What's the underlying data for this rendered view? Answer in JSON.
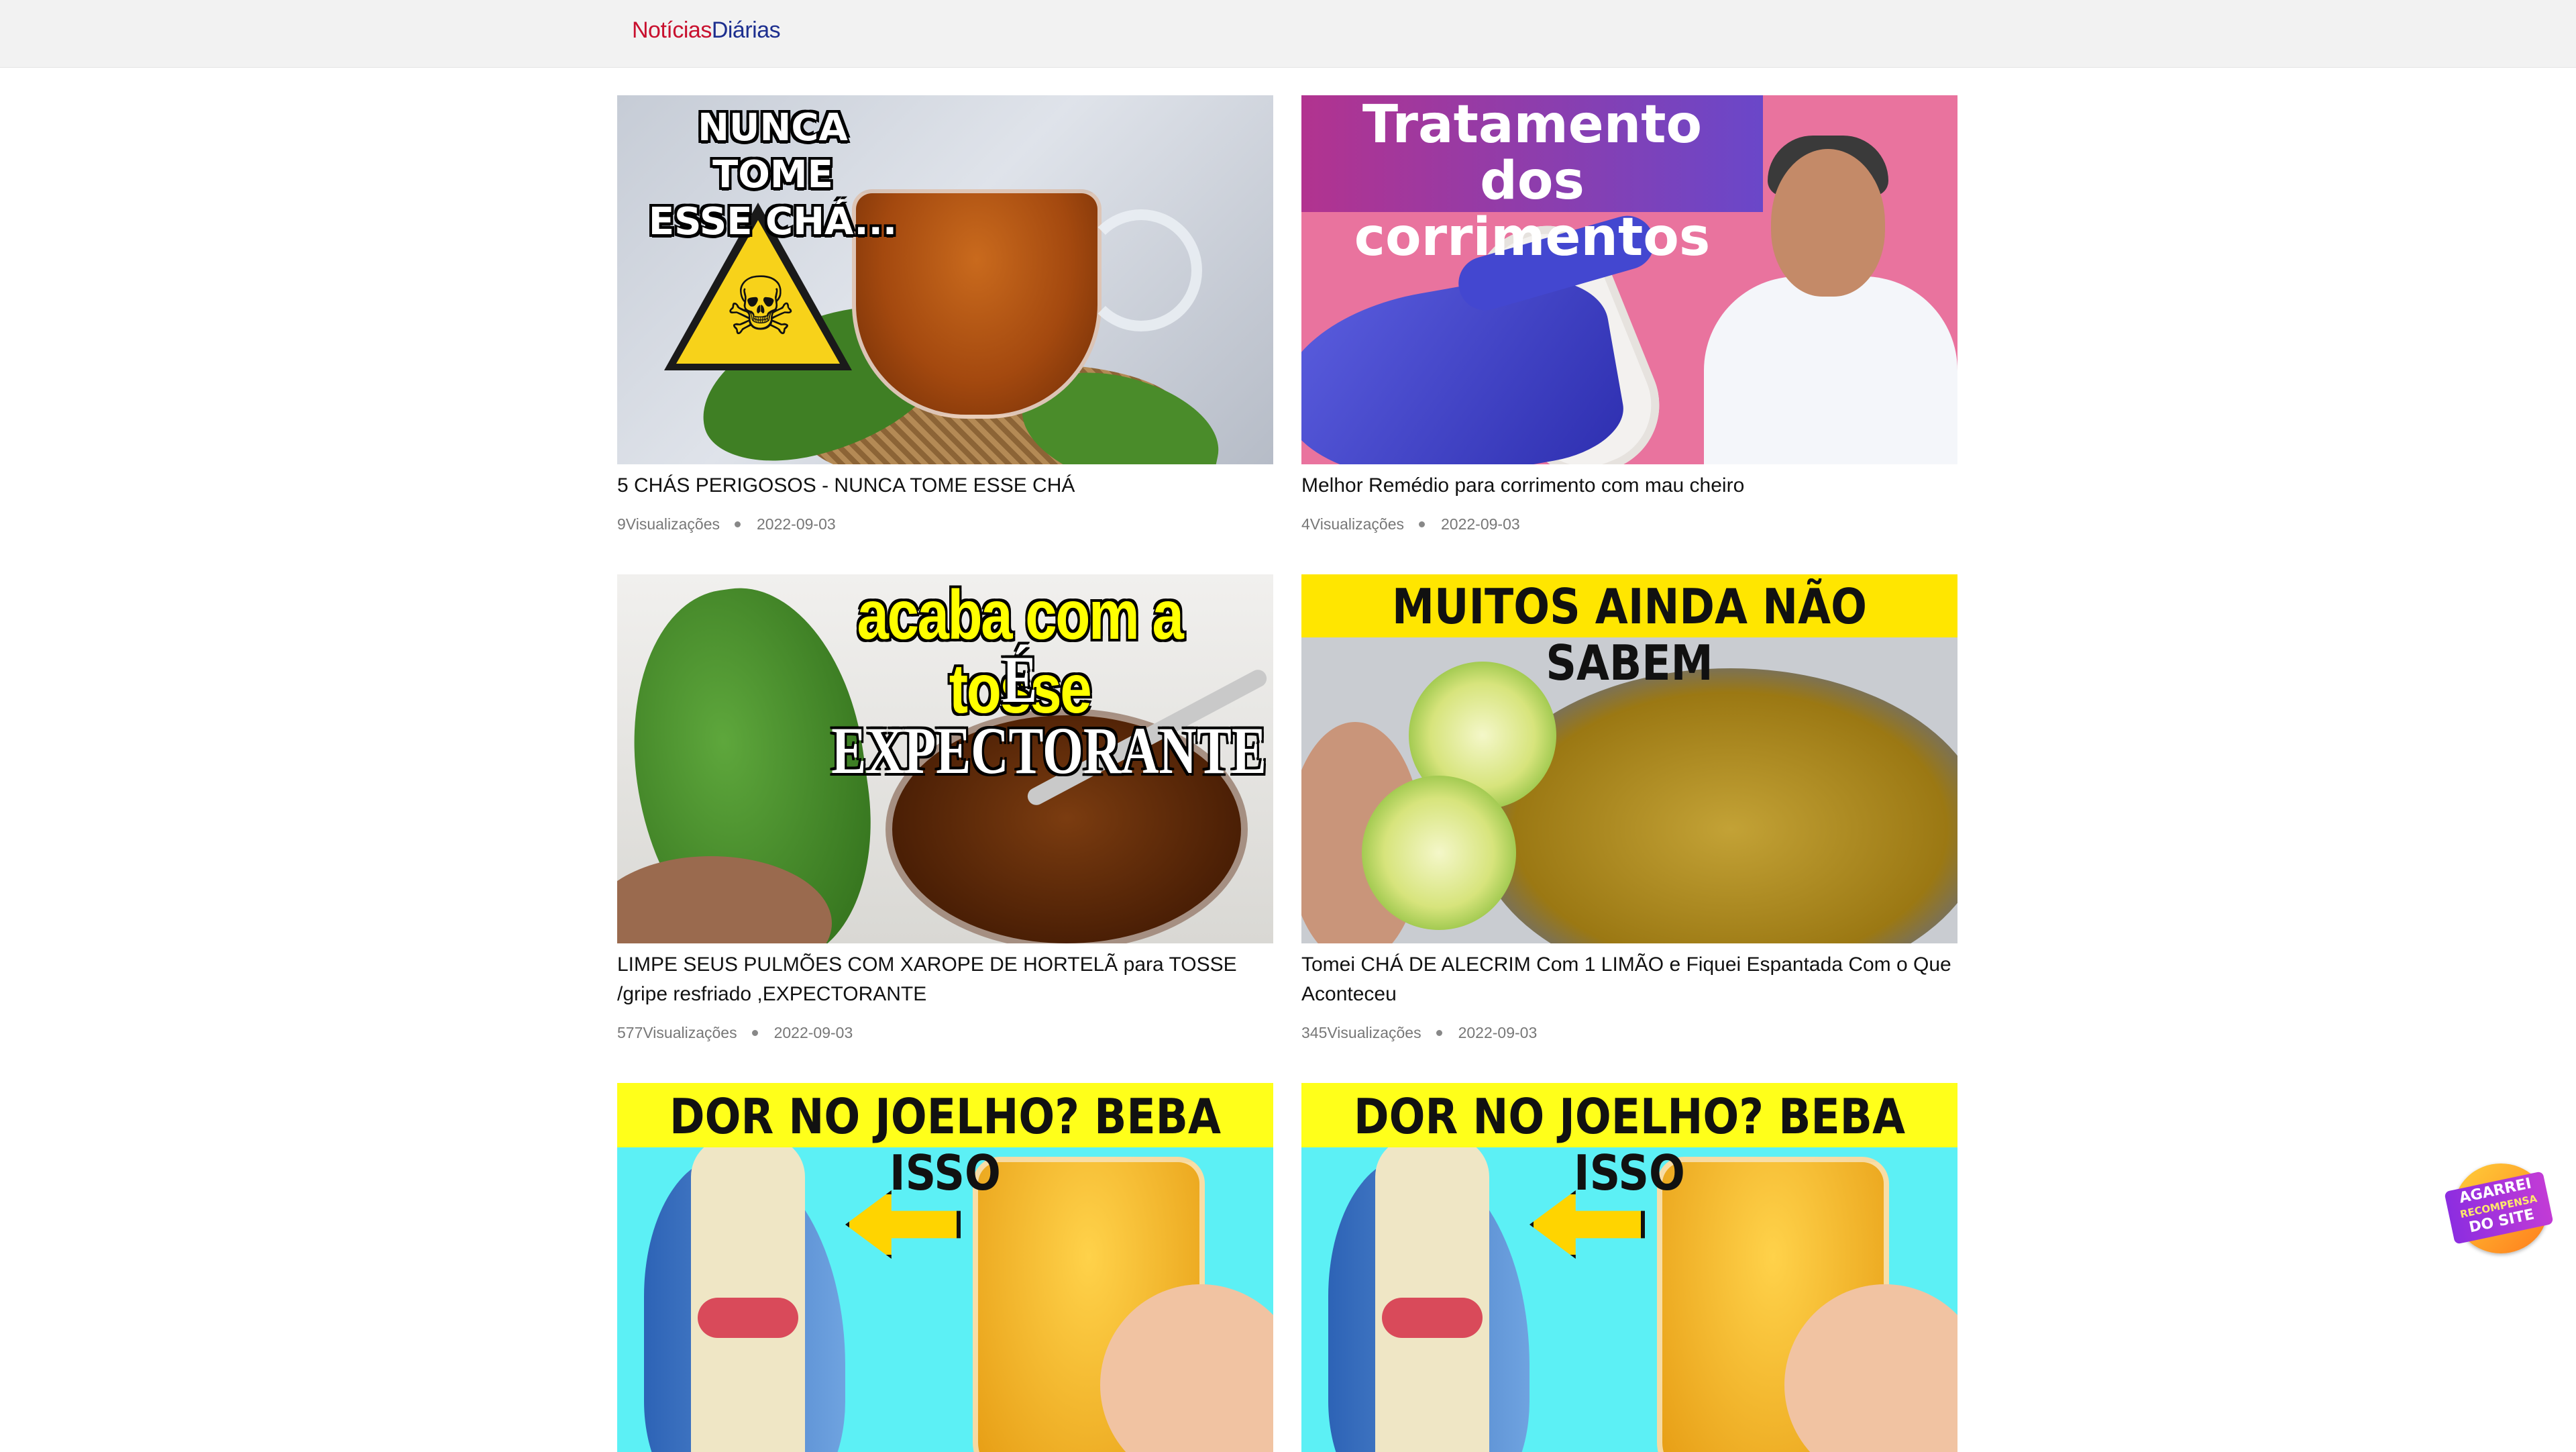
{
  "header": {
    "logo_part1": "Notícias",
    "logo_part2": "Diárias",
    "logo_colors": [
      "#c8102e",
      "#1d2f8f"
    ]
  },
  "articles": [
    {
      "title": "5 CHÁS PERIGOSOS - NUNCA TOME ESSE CHÁ",
      "views": "9Visualizações",
      "date": "2022-09-03",
      "thumb_caption": [
        "NUNCA TOME",
        "ESSE CHÁ..."
      ]
    },
    {
      "title": "Melhor Remédio para corrimento com mau cheiro",
      "views": "4Visualizações",
      "date": "2022-09-03",
      "thumb_caption": [
        "Tratamento dos",
        "corrimentos"
      ]
    },
    {
      "title": "LIMPE SEUS PULMÕES COM XAROPE DE HORTELÃ para TOSSE /gripe resfriado ,EXPECTORANTE",
      "views": "577Visualizações",
      "date": "2022-09-03",
      "thumb_caption": [
        "acaba com a tosse",
        "É EXPECTORANTE"
      ]
    },
    {
      "title": "Tomei CHÁ DE ALECRIM Com 1 LIMÃO e Fiquei Espantada Com o Que Aconteceu",
      "views": "345Visualizações",
      "date": "2022-09-03",
      "thumb_caption": [
        "MUITOS AINDA NÃO SABEM"
      ]
    },
    {
      "thumb_caption": [
        "DOR NO JOELHO? BEBA ISSO"
      ]
    },
    {
      "thumb_caption": [
        "DOR NO JOELHO? BEBA ISSO"
      ]
    }
  ],
  "reward_badge": {
    "line1": "AGARREI",
    "line2": "RECOMPENSA",
    "line3": "DO SITE"
  }
}
